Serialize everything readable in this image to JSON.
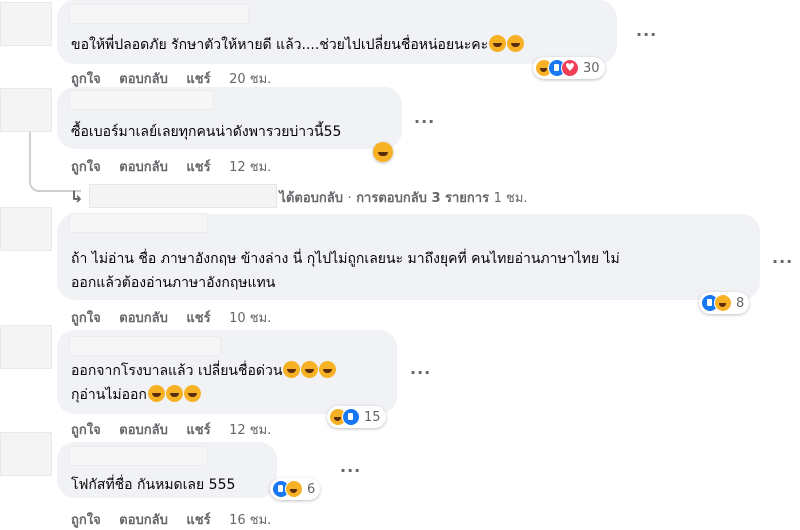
{
  "labels": {
    "like": "ถูกใจ",
    "reply": "ตอบกลับ",
    "share": "แชร์"
  },
  "comments": [
    {
      "text": "ขอให้พี่ปลอดภัย รักษาตัวให้หายดี แล้ว....ช่วยไปเปลี่ยนชื่อหน่อยนะคะ",
      "time": "20 ชม.",
      "reactions": [
        "haha",
        "like",
        "love"
      ],
      "reaction_count": "30"
    },
    {
      "text": "ซื้อเบอร์มาเลย์เลยทุกคนน่าดังพารวยบ่าวนี้55",
      "time": "12 ชม.",
      "reactions": [
        "haha"
      ],
      "reaction_count": ""
    },
    {
      "line1": "ถ้า ไม่อ่าน ชื่อ ภาษาอังกฤษ ข้างล่าง นี่ กุไปไม่ถูกเลยนะ มาถึงยุคที่ คนไทยอ่านภาษาไทย ไม่",
      "line2": "ออกแล้วต้องอ่านภาษาอังกฤษแทน",
      "time": "10 ชม.",
      "reactions": [
        "like",
        "haha"
      ],
      "reaction_count": "8"
    },
    {
      "line1": "ออกจากโรงบาลแล้ว เปลี่ยนชื่อด่วน",
      "line2": "กุอ่านไม่ออก",
      "time": "12 ชม.",
      "reactions": [
        "haha",
        "like"
      ],
      "reaction_count": "15"
    },
    {
      "text": "โฟกัสที่ชื่อ กันหมดเลย 555",
      "time": "16 ชม.",
      "reactions": [
        "like",
        "haha"
      ],
      "reaction_count": "6"
    }
  ],
  "reply_summary": {
    "text": "ได้ตอบกลับ",
    "separator": "·",
    "count_text": "การตอบกลับ 3 รายการ",
    "time": "1 ชม."
  },
  "more_glyph": "···"
}
